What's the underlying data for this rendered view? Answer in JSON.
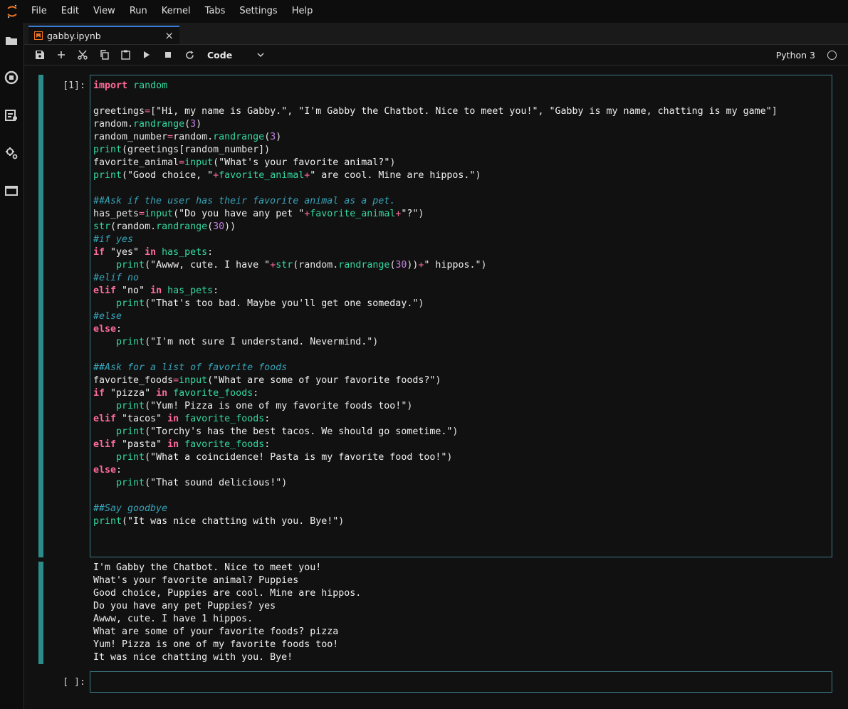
{
  "menu": [
    "File",
    "Edit",
    "View",
    "Run",
    "Kernel",
    "Tabs",
    "Settings",
    "Help"
  ],
  "tab": {
    "label": "gabby.ipynb",
    "close": "×"
  },
  "toolbar": {
    "cell_type": "Code",
    "kernel": "Python 3"
  },
  "cells": [
    {
      "prompt": "[1]:",
      "code": [
        "import random",
        "",
        "greetings=[\"Hi, my name is Gabby.\", \"I'm Gabby the Chatbot. Nice to meet you!\", \"Gabby is my name, chatting is my game\"]",
        "random.randrange(3)",
        "random_number=random.randrange(3)",
        "print(greetings[random_number])",
        "favorite_animal=input(\"What's your favorite animal?\")",
        "print(\"Good choice, \"+favorite_animal+\" are cool. Mine are hippos.\")",
        "",
        "##Ask if the user has their favorite animal as a pet.",
        "has_pets=input(\"Do you have any pet \"+favorite_animal+\"?\")",
        "str(random.randrange(30))",
        "#if yes",
        "if \"yes\" in has_pets:",
        "    print(\"Awww, cute. I have \"+str(random.randrange(30))+\" hippos.\")",
        "#elif no",
        "elif \"no\" in has_pets:",
        "    print(\"That's too bad. Maybe you'll get one someday.\")",
        "#else",
        "else:",
        "    print(\"I'm not sure I understand. Nevermind.\")",
        "",
        "##Ask for a list of favorite foods",
        "favorite_foods=input(\"What are some of your favorite foods?\")",
        "if \"pizza\" in favorite_foods:",
        "    print(\"Yum! Pizza is one of my favorite foods too!\")",
        "elif \"tacos\" in favorite_foods:",
        "    print(\"Torchy's has the best tacos. We should go sometime.\")",
        "elif \"pasta\" in favorite_foods:",
        "    print(\"What a coincidence! Pasta is my favorite food too!\")",
        "else:",
        "    print(\"That sound delicious!\")",
        "",
        "##Say goodbye",
        "print(\"It was nice chatting with you. Bye!\")"
      ],
      "output": [
        "I'm Gabby the Chatbot. Nice to meet you!",
        "What's your favorite animal? Puppies",
        "Good choice, Puppies are cool. Mine are hippos.",
        "Do you have any pet Puppies? yes",
        "Awww, cute. I have 1 hippos.",
        "What are some of your favorite foods? pizza",
        "Yum! Pizza is one of my favorite foods too!",
        "It was nice chatting with you. Bye!"
      ]
    },
    {
      "prompt": "[ ]:"
    }
  ],
  "icons": {
    "sidebar": [
      "folder-icon",
      "running-icon",
      "commands-icon",
      "extensions-icon",
      "tabs-icon"
    ],
    "toolbar": [
      "save-icon",
      "add-cell-icon",
      "cut-icon",
      "copy-icon",
      "paste-icon",
      "run-icon",
      "stop-icon",
      "restart-icon"
    ]
  },
  "colors": {
    "accent": "#3a7bd5",
    "collapser": "#2c8c8c",
    "keyword": "#ff6b9a",
    "builtin": "#33d9a0",
    "number": "#c27de0",
    "comment": "#37a3b8"
  }
}
